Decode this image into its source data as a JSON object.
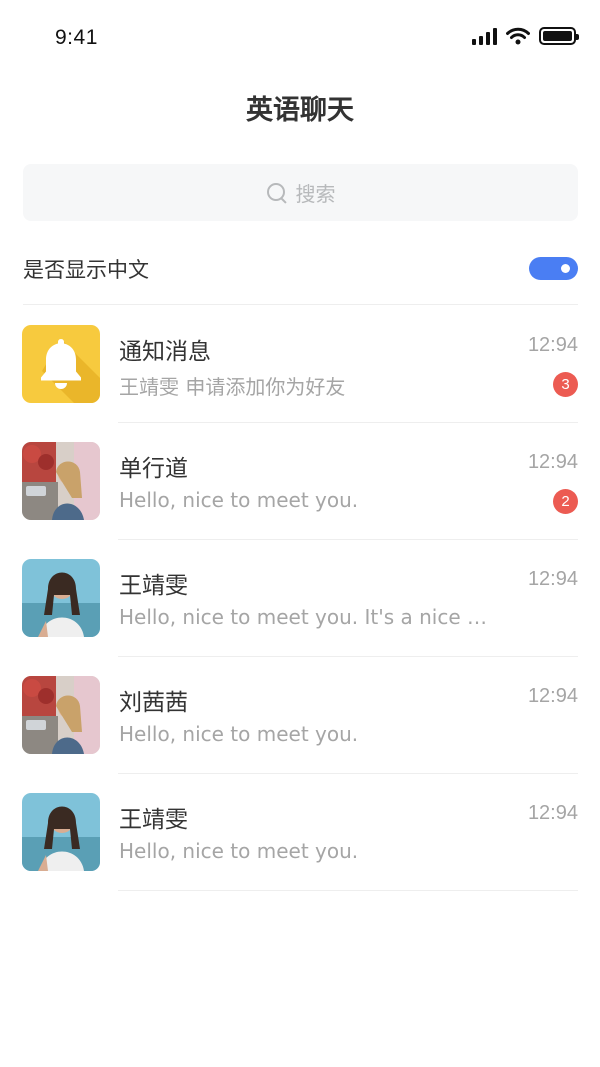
{
  "status_bar": {
    "time": "9:41"
  },
  "header": {
    "title": "英语聊天"
  },
  "search": {
    "placeholder": "搜索",
    "icon": "search-icon"
  },
  "settings": {
    "show_chinese_label": "是否显示中文",
    "show_chinese_enabled": true,
    "toggle_color": "#4a7ef3"
  },
  "colors": {
    "badge": "#ec5b52",
    "notification_avatar": "#f7ca3e",
    "secondary_text": "#a5a5a5"
  },
  "chats": [
    {
      "name": "通知消息",
      "time": "12:94",
      "message": "王靖雯 申请添加你为好友",
      "badge": "3",
      "avatar": "bell-icon"
    },
    {
      "name": "单行道",
      "time": "12:94",
      "message": "Hello, nice to meet you.",
      "badge": "2",
      "avatar": "photo-a"
    },
    {
      "name": "王靖雯",
      "time": "12:94",
      "message": "Hello, nice to meet you. It's a nice day …",
      "badge": "",
      "avatar": "photo-b"
    },
    {
      "name": "刘茜茜",
      "time": "12:94",
      "message": "Hello, nice to meet you.",
      "badge": "",
      "avatar": "photo-a"
    },
    {
      "name": "王靖雯",
      "time": "12:94",
      "message": "Hello, nice to meet you.",
      "badge": "",
      "avatar": "photo-b"
    }
  ]
}
